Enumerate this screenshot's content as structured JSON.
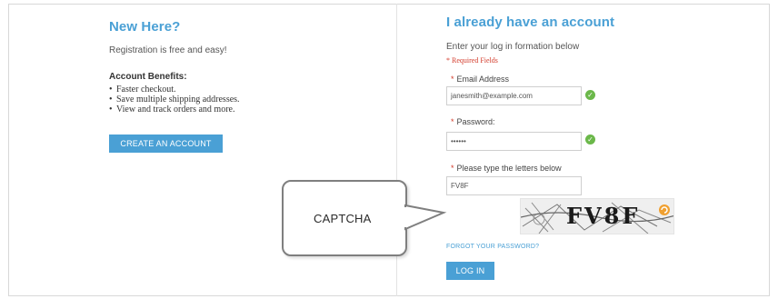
{
  "left": {
    "title": "New Here?",
    "registration_note": "Registration is free and easy!",
    "benefits_title": "Account Benefits:",
    "benefits": [
      "Faster checkout.",
      "Save multiple shipping addresses.",
      "View and track orders and more."
    ],
    "create_button": "CREATE AN ACCOUNT"
  },
  "right": {
    "title": "I already have an account",
    "intro": "Enter your log in formation below",
    "required_note": "* Required Fields",
    "email": {
      "label": "Email Address",
      "value": "janesmith@example.com"
    },
    "password": {
      "label": "Password:",
      "value": "••••••"
    },
    "captcha": {
      "label": "Please type the letters below",
      "value": "FV8F",
      "image_text": "FV8F"
    },
    "forgot_link": "FORGOT YOUR PASSWORD?",
    "login_button": "LOG IN"
  },
  "callout": {
    "text": "CAPTCHA"
  },
  "colors": {
    "accent": "#4aa0d5",
    "required": "#d33a2a",
    "valid": "#6bb84a"
  },
  "icons": {
    "valid": "check-circle-icon",
    "captcha_refresh": "refresh-icon"
  }
}
